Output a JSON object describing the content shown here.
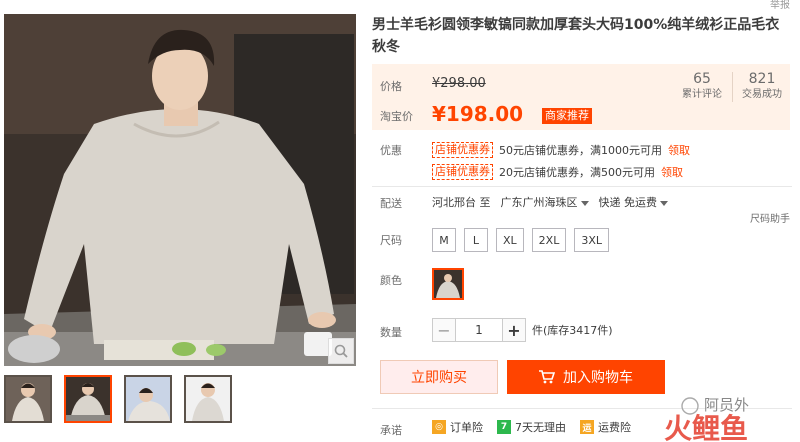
{
  "header": {
    "top_link": "举报"
  },
  "gallery": {
    "main_image_alt": "product-main-photo",
    "thumbnails": [
      {
        "name": "thumb-1"
      },
      {
        "name": "thumb-2",
        "active": true
      },
      {
        "name": "thumb-3"
      },
      {
        "name": "thumb-4"
      }
    ]
  },
  "product": {
    "title": "男士羊毛衫圆领李敏镐同款加厚套头大码100%纯羊绒衫正品毛衣秋冬"
  },
  "price": {
    "orig_label": "价格",
    "orig_value": "¥298.00",
    "now_label": "淘宝价",
    "now_value": "¥198.00",
    "badge": "商家推荐"
  },
  "stats": {
    "reviews_count": "65",
    "reviews_label": "累计评论",
    "sales_count": "821",
    "sales_label": "交易成功"
  },
  "coupons": {
    "label": "优惠",
    "items": [
      {
        "tag": "店铺优惠券",
        "text": "50元店铺优惠券，满1000元可用",
        "link": "领取"
      },
      {
        "tag": "店铺优惠券",
        "text": "20元店铺优惠券，满500元可用",
        "link": "领取"
      }
    ]
  },
  "shipping": {
    "label": "配送",
    "from": "河北邢台 至",
    "to": "广东广州海珠区",
    "method": "快递 免运费"
  },
  "size_helper": "尺码助手",
  "size": {
    "label": "尺码",
    "options": [
      "M",
      "L",
      "XL",
      "2XL",
      "3XL"
    ]
  },
  "color": {
    "label": "颜色"
  },
  "quantity": {
    "label": "数量",
    "value": "1",
    "minus": "−",
    "plus": "+",
    "stock": "件(库存3417件)"
  },
  "actions": {
    "buy_now": "立即购买",
    "add_cart": "加入购物车"
  },
  "promise": {
    "label": "承诺",
    "items": [
      "订单险",
      "7天无理由",
      "运费险"
    ],
    "icon_colors": [
      "#f5a623",
      "#2db84d",
      "#f5a623"
    ],
    "icon_glyphs": [
      "◎",
      "7",
      "运"
    ]
  },
  "watermark": {
    "text": "阿员外",
    "brand": "火鲤鱼"
  },
  "colors": {
    "accent": "#ff4400",
    "price_bg": "#fff2e8"
  }
}
